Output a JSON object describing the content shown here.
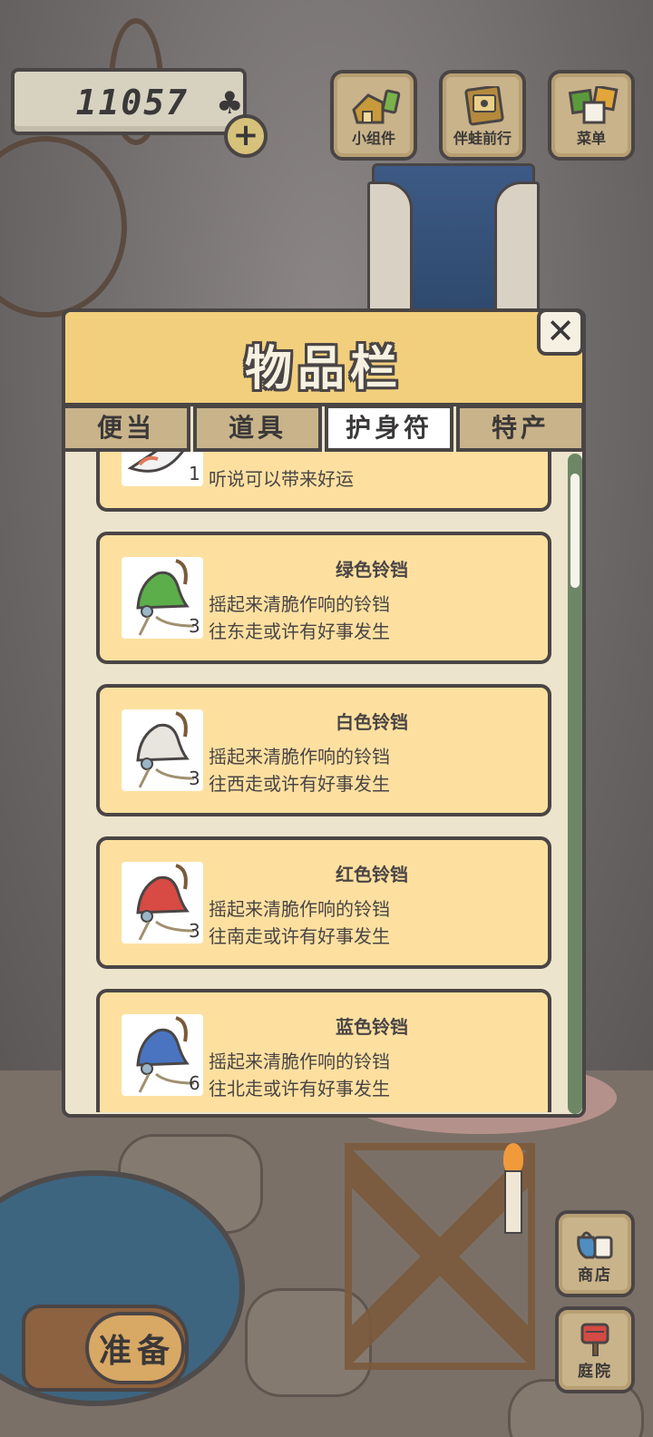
{
  "currency": {
    "amount": "11057",
    "icon": "clover-icon",
    "add_icon": "plus-icon"
  },
  "top_buttons": [
    {
      "label": "小组件",
      "icon": "widget-icon"
    },
    {
      "label": "伴蛙前行",
      "icon": "album-icon"
    },
    {
      "label": "菜单",
      "icon": "menu-cards-icon"
    }
  ],
  "panel": {
    "title": "物品栏",
    "close_symbol": "✕",
    "tabs": [
      {
        "label": "便当",
        "active": false
      },
      {
        "label": "道具",
        "active": false
      },
      {
        "label": "护身符",
        "active": true
      },
      {
        "label": "特产",
        "active": false
      }
    ],
    "items": [
      {
        "name": "",
        "desc1": "",
        "desc2": "听说可以带来好运",
        "count": "1",
        "icon": "koi-icon",
        "color": "#f0f0f0"
      },
      {
        "name": "绿色铃铛",
        "desc1": "摇起来清脆作响的铃铛",
        "desc2": "往东走或许有好事发生",
        "count": "3",
        "icon": "bell-icon",
        "color": "#5cae4a"
      },
      {
        "name": "白色铃铛",
        "desc1": "摇起来清脆作响的铃铛",
        "desc2": "往西走或许有好事发生",
        "count": "3",
        "icon": "bell-icon",
        "color": "#e8e4de"
      },
      {
        "name": "红色铃铛",
        "desc1": "摇起来清脆作响的铃铛",
        "desc2": "往南走或许有好事发生",
        "count": "3",
        "icon": "bell-icon",
        "color": "#d84a44"
      },
      {
        "name": "蓝色铃铛",
        "desc1": "摇起来清脆作响的铃铛",
        "desc2": "往北走或许有好事发生",
        "count": "6",
        "icon": "bell-icon",
        "color": "#4a74c0"
      }
    ]
  },
  "bottom": {
    "prepare_label": "准备",
    "shop_label": "商店",
    "yard_label": "庭院"
  },
  "colors": {
    "panel_header": "#f2cf7c",
    "item_card": "#fde0a0",
    "outline": "#4a4545",
    "scrollbar": "#6d8766"
  }
}
